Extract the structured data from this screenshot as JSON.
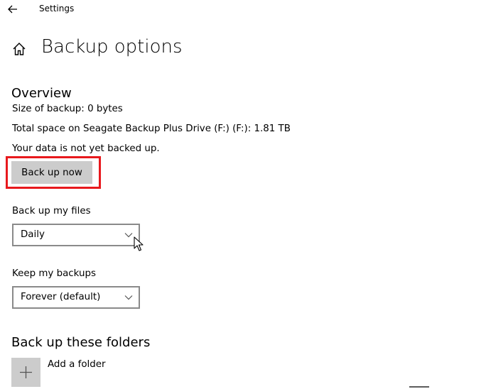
{
  "window": {
    "title": "Settings",
    "back_icon": "arrow-left-icon"
  },
  "header": {
    "title": "Backup options",
    "home_icon": "home-icon"
  },
  "overview": {
    "heading": "Overview",
    "size_of_backup": "Size of backup: 0 bytes",
    "total_space": "Total space on Seagate Backup Plus Drive (F:) (F:): 1.81 TB",
    "status": "Your data is not yet backed up.",
    "back_up_now_label": "Back up now",
    "highlight_color": "#e8191d"
  },
  "backup_files": {
    "label": "Back up my files",
    "selected": "Daily"
  },
  "keep_backups": {
    "label": "Keep my backups",
    "selected": "Forever (default)"
  },
  "folders": {
    "heading": "Back up these folders",
    "add_label": "Add a folder",
    "add_icon": "plus-icon"
  },
  "colors": {
    "button_bg": "#cccccc",
    "combo_border": "#8a8a8a"
  }
}
